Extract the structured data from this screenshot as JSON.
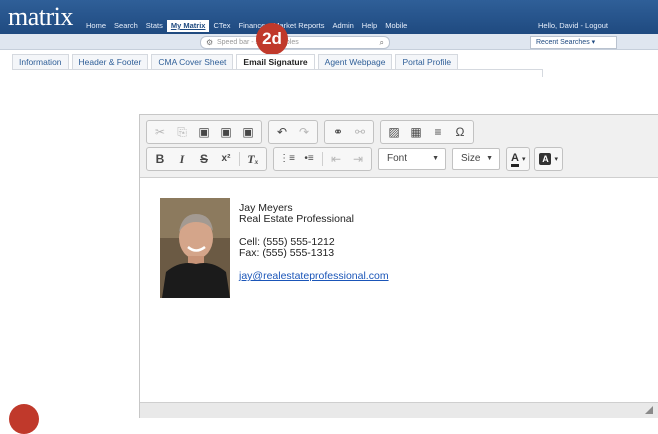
{
  "app": {
    "logo": "matrix"
  },
  "nav": {
    "items": [
      {
        "label": "Home",
        "active": false
      },
      {
        "label": "Search",
        "active": false
      },
      {
        "label": "Stats",
        "active": false
      },
      {
        "label": "My Matrix",
        "active": true
      },
      {
        "label": "CTex",
        "active": false
      },
      {
        "label": "Finance",
        "active": false
      },
      {
        "label": "Market Reports",
        "active": false
      },
      {
        "label": "Admin",
        "active": false
      },
      {
        "label": "Help",
        "active": false
      },
      {
        "label": "Mobile",
        "active": false
      }
    ],
    "user_greeting": "Hello, David - Logout"
  },
  "search": {
    "placeholder": "Speed bar - see examples",
    "recent_label": "Recent Searches"
  },
  "callouts": {
    "top": "2d"
  },
  "tabs": [
    {
      "label": "Information",
      "active": false
    },
    {
      "label": "Header & Footer",
      "active": false
    },
    {
      "label": "CMA Cover Sheet",
      "active": false
    },
    {
      "label": "Email Signature",
      "active": true
    },
    {
      "label": "Agent Webpage",
      "active": false
    },
    {
      "label": "Portal Profile",
      "active": false
    }
  ],
  "editor": {
    "font_label": "Font",
    "size_label": "Size",
    "text_color_glyph": "A",
    "bg_color_glyph": "A",
    "icons": {
      "cut": "✂",
      "copy": "⎘",
      "paste": "▣",
      "paste_text": "▣",
      "paste_word": "▣",
      "undo": "↶",
      "redo": "↷",
      "link": "⚭",
      "unlink": "⚯",
      "image": "▨",
      "table": "▦",
      "hr": "≡",
      "special_char": "Ω",
      "bold": "B",
      "italic": "I",
      "strike": "S",
      "superscript": "x²",
      "remove_format": "Tₓ",
      "ordered_list": "⋮≡",
      "bullet_list": "•≡",
      "outdent": "⇤",
      "indent": "⇥"
    }
  },
  "signature": {
    "name": "Jay Meyers",
    "title": "Real Estate Professional",
    "cell": "Cell: (555) 555-1212",
    "fax": "Fax: (555) 555-1313",
    "email": "jay@realestateprofessional.com"
  },
  "colors": {
    "nav_bg": "#1f4a80",
    "callout": "#c0392b",
    "link": "#1a55b8"
  }
}
